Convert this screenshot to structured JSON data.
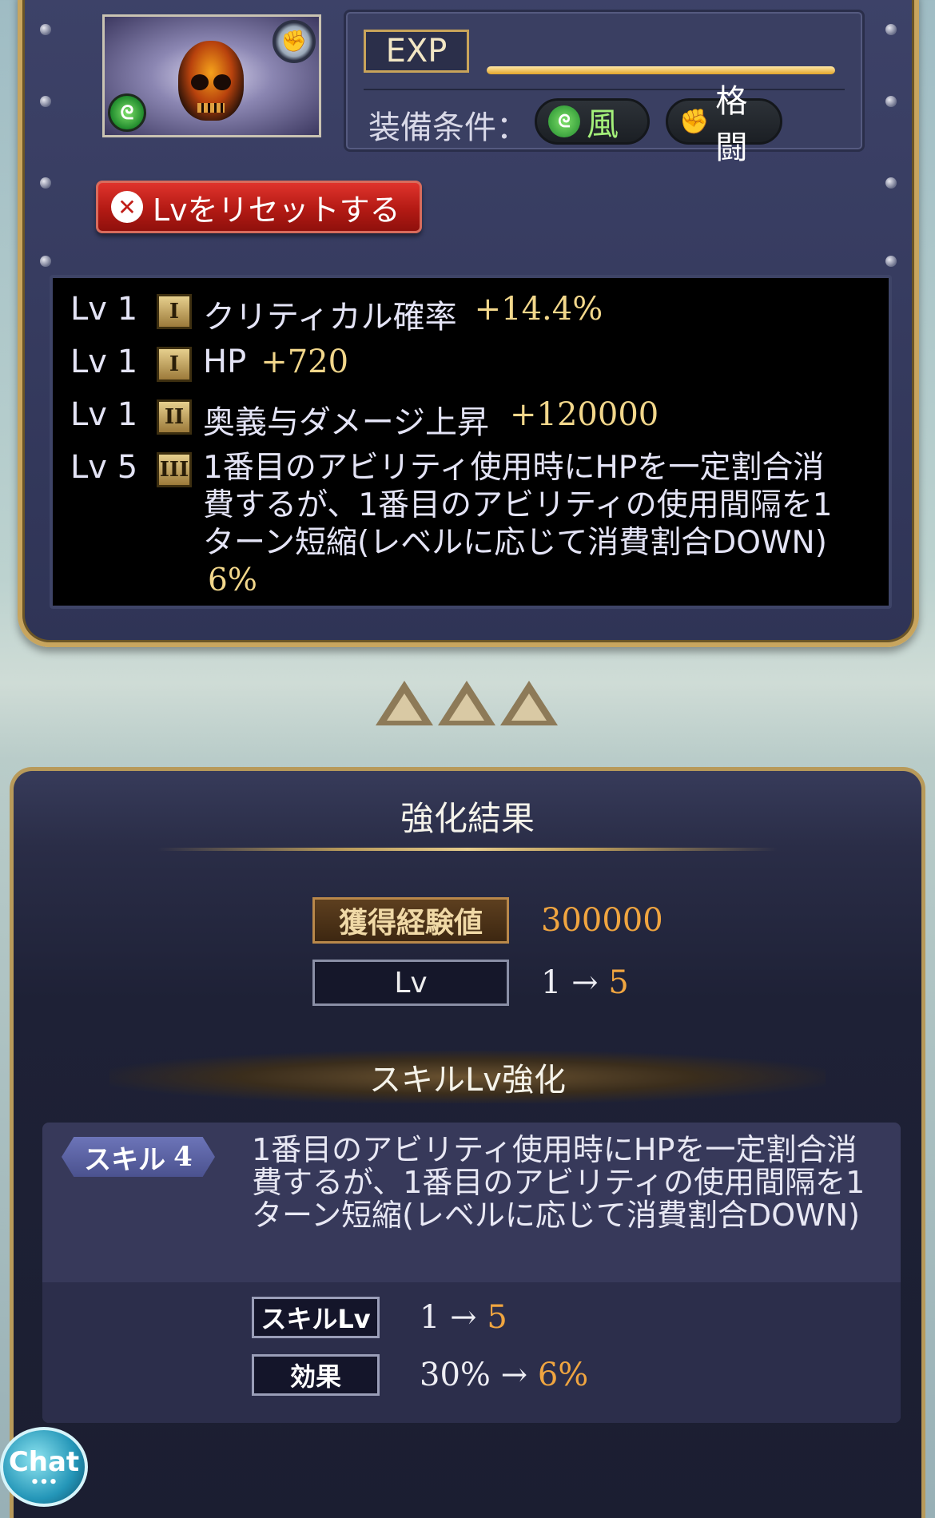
{
  "item": {
    "icons": {
      "weapon": "fist-icon",
      "element": "wind-icon",
      "skull": "skull-icon"
    }
  },
  "exp": {
    "label": "EXP",
    "progress": 1.0
  },
  "equip": {
    "label": "装備条件：",
    "element": "風",
    "weapon_type": "格闘"
  },
  "reset_button": {
    "label": "Lvをリセットする"
  },
  "skills_list": [
    {
      "lv_label": "Lv",
      "lv": "1",
      "rank": "I",
      "name": "クリティカル確率",
      "value": "+14.4%"
    },
    {
      "lv_label": "Lv",
      "lv": "1",
      "rank": "I",
      "name": "HP",
      "value": "+720"
    },
    {
      "lv_label": "Lv",
      "lv": "1",
      "rank": "II",
      "name": "奥義与ダメージ上昇",
      "value": "+120000"
    },
    {
      "lv_label": "Lv",
      "lv": "5",
      "rank": "III",
      "name": "1番目のアビリティ使用時にHPを一定割合消費するが、1番目のアビリティの使用間隔を1ターン短縮(レベルに応じて消費割合DOWN)",
      "value": "6%"
    }
  ],
  "result": {
    "title": "強化結果",
    "exp_label": "獲得経験値",
    "exp_value": "300000",
    "lv_label": "Lv",
    "lv_from": "1",
    "arrow": "→",
    "lv_to": "5"
  },
  "skill_upgrade": {
    "header": "スキルLv強化",
    "tag_label": "スキル",
    "tag_num": "4",
    "description": "1番目のアビリティ使用時にHPを一定割合消費するが、1番目のアビリティの使用間隔を1ターン短縮(レベルに応じて消費割合DOWN)",
    "skill_lv_label": "スキルLv",
    "skill_lv_from": "1",
    "skill_lv_to": "5",
    "effect_label": "効果",
    "effect_from": "30%",
    "effect_to": "6%"
  },
  "chat": {
    "label": "Chat",
    "dots": "•••"
  }
}
